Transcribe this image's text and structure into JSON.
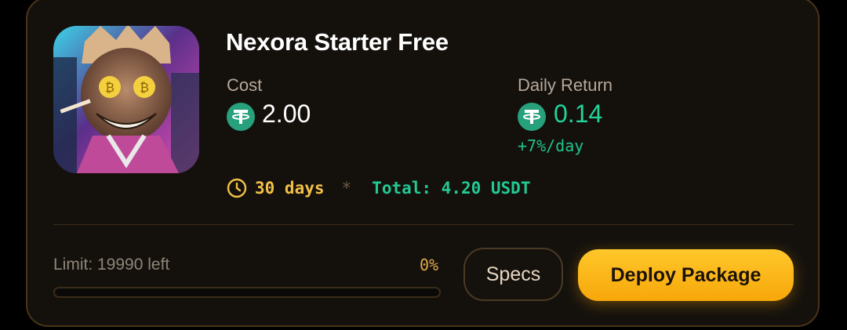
{
  "package": {
    "name": "Nexora Starter Free",
    "image_alt": "cartoon character with bitcoin eyes",
    "cost": {
      "label": "Cost",
      "value": "2.00",
      "currency_icon": "tether-coin-icon"
    },
    "daily_return": {
      "label": "Daily Return",
      "value": "0.14",
      "rate": "+7%/day",
      "currency_icon": "tether-coin-icon"
    },
    "duration": "30 days",
    "separator": "*",
    "total": "Total: 4.20 USDT"
  },
  "limit": {
    "text": "Limit: 19990 left",
    "percent_label": "0%",
    "progress_fraction": 0
  },
  "actions": {
    "specs_label": "Specs",
    "deploy_label": "Deploy Package"
  },
  "colors": {
    "card_bg": "#14110d",
    "card_border": "#4a3418",
    "return_green": "#22d39a",
    "duration_gold": "#f2c047",
    "deploy_gradient_top": "#ffc72a",
    "deploy_gradient_bottom": "#f7a70a",
    "tether_green": "#26a17b"
  }
}
